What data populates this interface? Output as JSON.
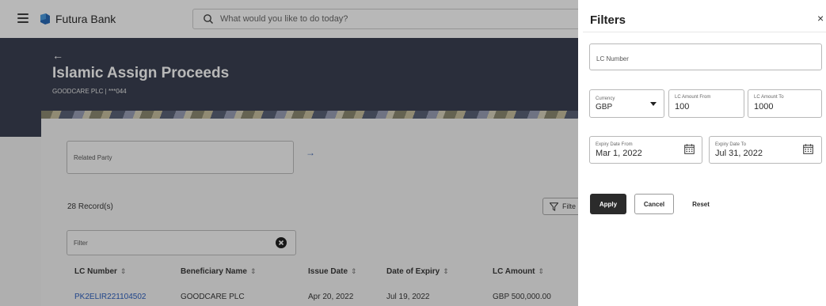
{
  "app": {
    "brand": "Futura Bank",
    "search_placeholder": "What would you like to do today?"
  },
  "page": {
    "back_arrow": "←",
    "title": "Islamic Assign Proceeds",
    "subtitle": "GOODCARE PLC | ***044"
  },
  "list": {
    "related_party_label": "Related Party",
    "related_party_arrow": "→",
    "records": "28 Record(s)",
    "filter_button": "Filte",
    "filter_field_label": "Filter",
    "columns": [
      {
        "label": "LC Number",
        "sort": "⇕"
      },
      {
        "label": "Beneficiary Name",
        "sort": "⇕"
      },
      {
        "label": "Issue Date",
        "sort": "⇕"
      },
      {
        "label": "Date of Expiry",
        "sort": "⇕"
      },
      {
        "label": "LC Amount",
        "sort": "⇕"
      }
    ],
    "rows": [
      {
        "lc_number": "PK2ELIR221104502",
        "beneficiary": "GOODCARE PLC",
        "issue_date": "Apr 20, 2022",
        "expiry": "Jul 19, 2022",
        "amount": "GBP 500,000.00"
      }
    ]
  },
  "filters": {
    "title": "Filters",
    "close": "×",
    "lc_number_placeholder": "LC Number",
    "currency": {
      "label": "Currency",
      "value": "GBP"
    },
    "amount_from": {
      "label": "LC Amount From",
      "value": "100"
    },
    "amount_to": {
      "label": "LC Amount To",
      "value": "1000"
    },
    "expiry_from": {
      "label": "Expiry Date From",
      "value": "Mar 1, 2022"
    },
    "expiry_to": {
      "label": "Expiry Date To",
      "value": "Jul 31, 2022"
    },
    "apply": "Apply",
    "cancel": "Cancel",
    "reset": "Reset"
  },
  "colors": {
    "hero": "#3b4152",
    "link": "#2f61c0",
    "primary_button": "#2b2b2b"
  }
}
